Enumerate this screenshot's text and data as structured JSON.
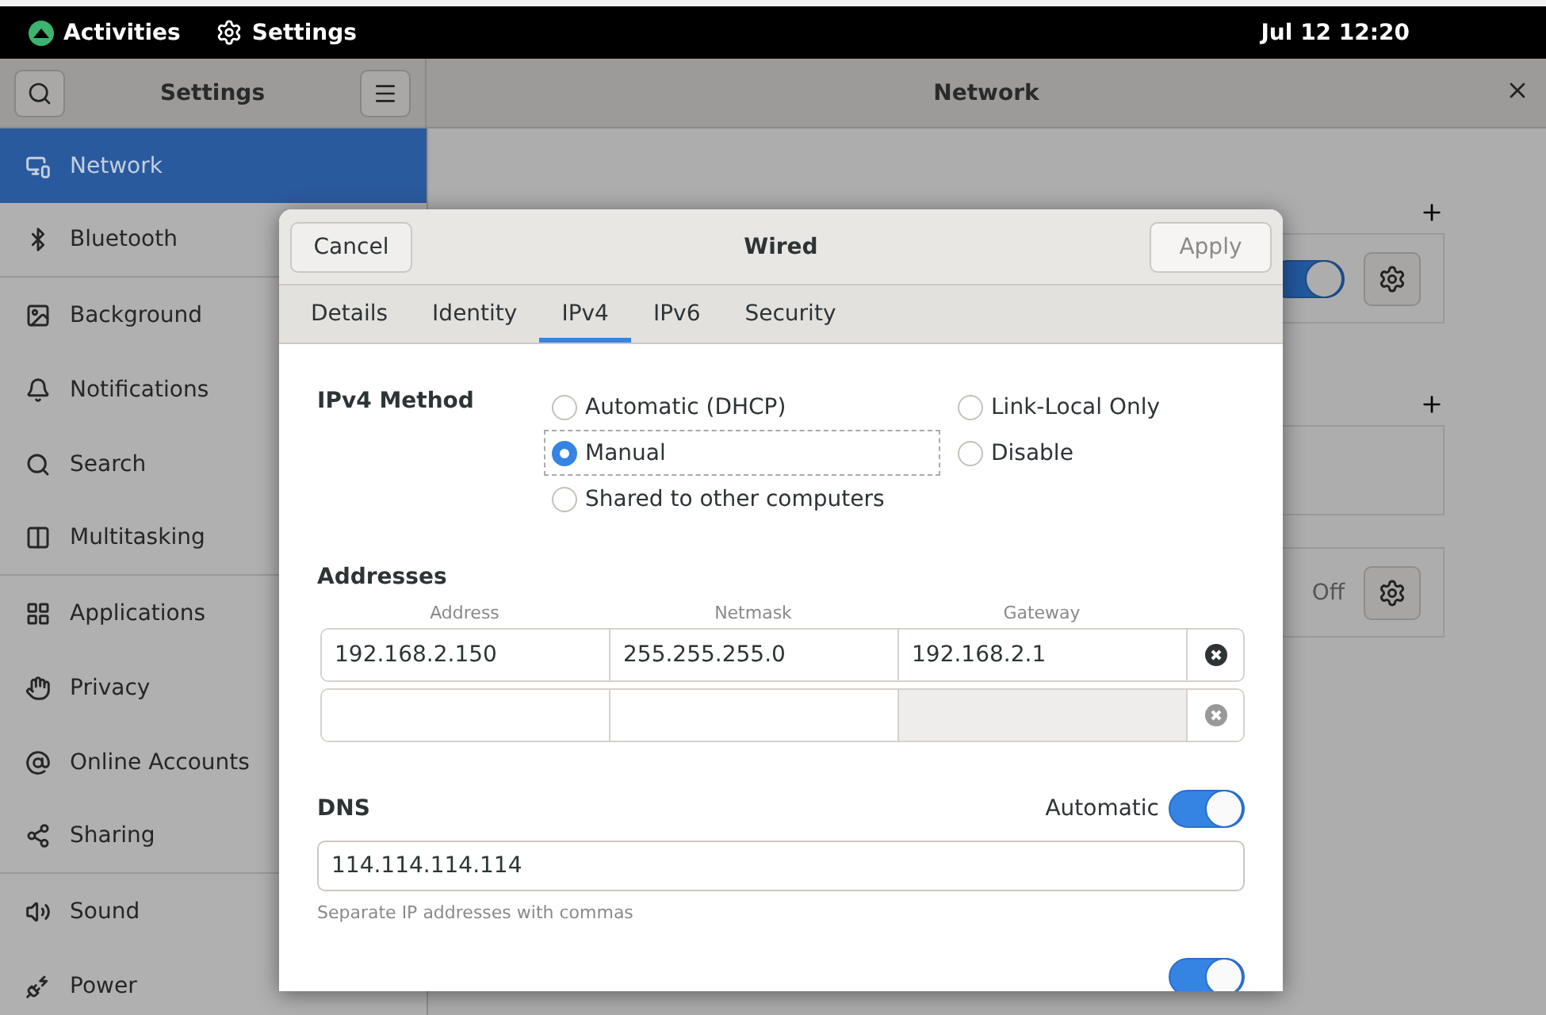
{
  "top_bar": {
    "activities": "Activities",
    "app_name": "Settings",
    "clock": "Jul 12  12:20"
  },
  "settings_header": {
    "title": "Settings",
    "panel_title": "Network"
  },
  "sidebar": {
    "items": [
      {
        "label": "Network",
        "selected": true
      },
      {
        "label": "Bluetooth",
        "selected": false
      },
      {
        "label": "Background",
        "selected": false
      },
      {
        "label": "Notifications",
        "selected": false
      },
      {
        "label": "Search",
        "selected": false
      },
      {
        "label": "Multitasking",
        "selected": false
      },
      {
        "label": "Applications",
        "selected": false
      },
      {
        "label": "Privacy",
        "selected": false
      },
      {
        "label": "Online Accounts",
        "selected": false
      },
      {
        "label": "Sharing",
        "selected": false
      },
      {
        "label": "Sound",
        "selected": false
      },
      {
        "label": "Power",
        "selected": false
      }
    ]
  },
  "network_panel": {
    "cards": [
      {
        "kind": "toggle",
        "on": true
      },
      {
        "kind": "empty"
      },
      {
        "kind": "status",
        "status": "Off"
      }
    ]
  },
  "dialog": {
    "cancel": "Cancel",
    "title": "Wired",
    "apply": "Apply",
    "apply_disabled": true,
    "tabs": [
      {
        "label": "Details",
        "selected": false
      },
      {
        "label": "Identity",
        "selected": false
      },
      {
        "label": "IPv4",
        "selected": true
      },
      {
        "label": "IPv6",
        "selected": false
      },
      {
        "label": "Security",
        "selected": false
      }
    ],
    "method": {
      "label": "IPv4 Method",
      "options": [
        {
          "label": "Automatic (DHCP)",
          "selected": false
        },
        {
          "label": "Link-Local Only",
          "selected": false
        },
        {
          "label": "Manual",
          "selected": true
        },
        {
          "label": "Disable",
          "selected": false
        },
        {
          "label": "Shared to other computers",
          "selected": false
        }
      ]
    },
    "addresses": {
      "label": "Addresses",
      "columns": [
        "Address",
        "Netmask",
        "Gateway"
      ],
      "rows": [
        {
          "address": "192.168.2.150",
          "netmask": "255.255.255.0",
          "gateway": "192.168.2.1",
          "active": true
        },
        {
          "active": false
        }
      ]
    },
    "dns": {
      "label": "DNS",
      "automatic_label": "Automatic",
      "automatic": true,
      "value": "114.114.114.114",
      "hint": "Separate IP addresses with commas"
    },
    "bottom_toggle": {
      "on": true
    }
  }
}
